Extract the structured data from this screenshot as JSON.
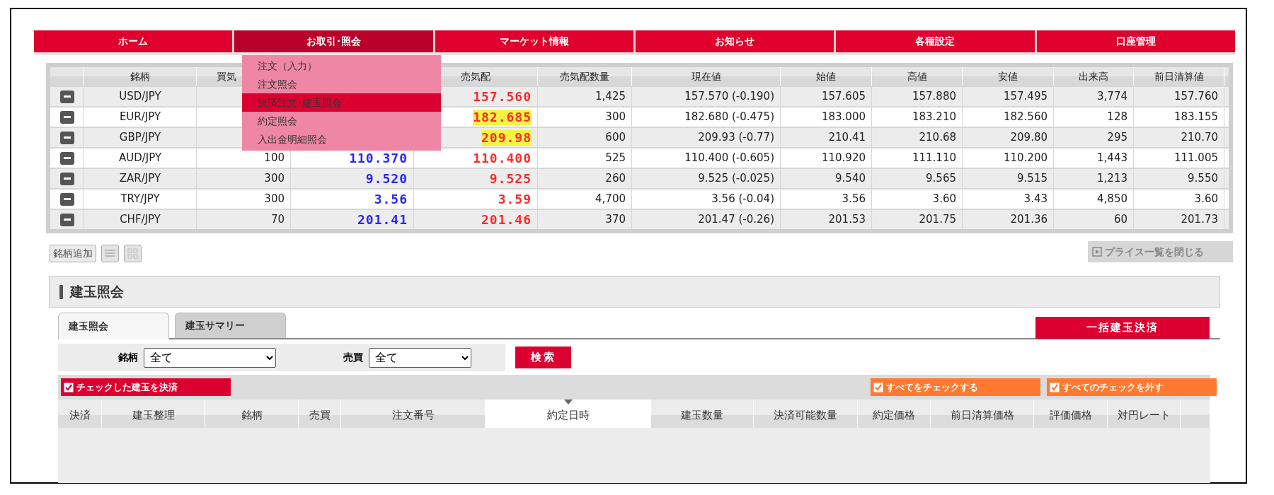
{
  "nav": [
    {
      "label": "ホーム",
      "selected": false
    },
    {
      "label": "お取引･照会",
      "selected": true
    },
    {
      "label": "マーケット情報",
      "selected": false
    },
    {
      "label": "お知らせ",
      "selected": false
    },
    {
      "label": "各種設定",
      "selected": false
    },
    {
      "label": "口座管理",
      "selected": false
    }
  ],
  "dropdown": [
    {
      "label": "注文（入力）",
      "selected": false
    },
    {
      "label": "注文照会",
      "selected": false
    },
    {
      "label": "決済注文･建玉照会",
      "selected": true
    },
    {
      "label": "約定照会",
      "selected": false
    },
    {
      "label": "入出金明細照会",
      "selected": false
    }
  ],
  "price_table": {
    "columns": [
      "銘柄",
      "買気",
      "売気配",
      "売気配数量",
      "現在値",
      "始値",
      "高値",
      "安値",
      "出来高",
      "前日清算値"
    ],
    "rows": [
      {
        "symbol": "USD/JPY",
        "ask": "157.560",
        "ask_highlighted": false,
        "ask_qty": "1,425",
        "current": "157.570 (-0.190)",
        "open": "157.605",
        "high": "157.880",
        "low": "157.495",
        "volume": "3,774",
        "prev_settle": "157.760"
      },
      {
        "symbol": "EUR/JPY",
        "ask": "182.685",
        "ask_highlighted": true,
        "ask_qty": "300",
        "current": "182.680 (-0.475)",
        "open": "183.000",
        "high": "183.210",
        "low": "182.560",
        "volume": "128",
        "prev_settle": "183.155"
      },
      {
        "symbol": "GBP/JPY",
        "ask": "209.98",
        "ask_highlighted": true,
        "ask_qty": "600",
        "current": "209.93 (-0.77)",
        "open": "210.41",
        "high": "210.68",
        "low": "209.80",
        "volume": "295",
        "prev_settle": "210.70"
      },
      {
        "symbol": "AUD/JPY",
        "bid_qty": "100",
        "bid": "110.370",
        "ask": "110.400",
        "ask_highlighted": false,
        "ask_qty": "525",
        "current": "110.400 (-0.605)",
        "open": "110.920",
        "high": "111.110",
        "low": "110.200",
        "volume": "1,443",
        "prev_settle": "111.005"
      },
      {
        "symbol": "ZAR/JPY",
        "bid_qty": "300",
        "bid": "9.520",
        "ask": "9.525",
        "ask_highlighted": false,
        "ask_qty": "260",
        "current": "9.525 (-0.025)",
        "open": "9.540",
        "high": "9.565",
        "low": "9.515",
        "volume": "1,213",
        "prev_settle": "9.550"
      },
      {
        "symbol": "TRY/JPY",
        "bid_qty": "300",
        "bid": "3.56",
        "ask": "3.59",
        "ask_highlighted": false,
        "ask_qty": "4,700",
        "current": "3.56 (-0.04)",
        "open": "3.56",
        "high": "3.60",
        "low": "3.43",
        "volume": "4,850",
        "prev_settle": "3.60"
      },
      {
        "symbol": "CHF/JPY",
        "bid_qty": "70",
        "bid": "201.41",
        "ask": "201.46",
        "ask_highlighted": false,
        "ask_qty": "370",
        "current": "201.47 (-0.26)",
        "open": "201.53",
        "high": "201.75",
        "low": "201.36",
        "volume": "60",
        "prev_settle": "201.73"
      }
    ]
  },
  "add_symbol_button": "銘柄追加",
  "close_price_button": "プライス一覧を閉じる",
  "section_title": "建玉照会",
  "tabs": [
    {
      "label": "建玉照会",
      "selected": true
    },
    {
      "label": "建玉サマリー",
      "selected": false
    }
  ],
  "bulk_settle_button": "一括建玉決済",
  "filters": [
    {
      "label": "銘柄",
      "value": "全て"
    },
    {
      "label": "売買",
      "value": "全て"
    }
  ],
  "search_button": "検索",
  "settle_checked_button": "チェックした建玉を決済",
  "check_all_button": "すべてをチェックする",
  "uncheck_all_button": "すべてのチェックを外す",
  "positions_table": {
    "columns": [
      {
        "label": "決済",
        "sorted": false
      },
      {
        "label": "建玉整理",
        "sorted": false
      },
      {
        "label": "銘柄",
        "sorted": false
      },
      {
        "label": "売買",
        "sorted": false
      },
      {
        "label": "注文番号",
        "sorted": false
      },
      {
        "label": "約定日時",
        "sorted": true
      },
      {
        "label": "建玉数量",
        "sorted": false
      },
      {
        "label": "決済可能数量",
        "sorted": false
      },
      {
        "label": "約定価格",
        "sorted": false
      },
      {
        "label": "前日清算価格",
        "sorted": false
      },
      {
        "label": "評価価格",
        "sorted": false
      },
      {
        "label": "対円レート",
        "sorted": false
      }
    ]
  }
}
